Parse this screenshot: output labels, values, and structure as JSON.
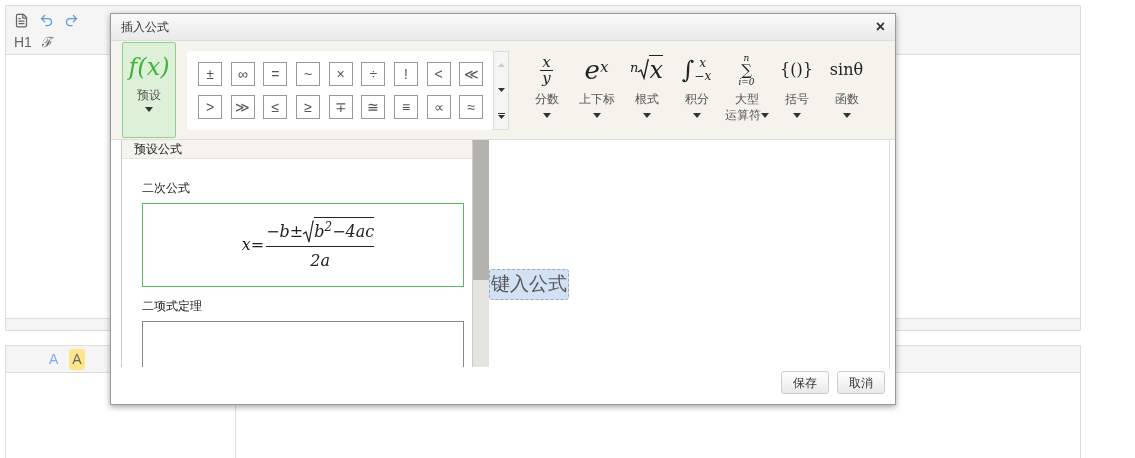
{
  "top_editor": {
    "toolbar": [
      {
        "label": "H1"
      },
      {
        "label": "ℱ"
      }
    ]
  },
  "bottom_editor": {
    "toolbar": [
      {
        "kind": "font-color",
        "label": "A"
      },
      {
        "kind": "highlight",
        "label": "A"
      }
    ]
  },
  "dialog": {
    "title": "插入公式",
    "close": "×",
    "preset": {
      "symbol": "f(x)",
      "label": "预设",
      "selected": true
    },
    "symbols": [
      "±",
      "∞",
      "=",
      "~",
      "×",
      "÷",
      "!",
      "<",
      "≪",
      ">",
      "≫",
      "≤",
      "≥",
      "∓",
      "≅",
      "≡",
      "∝",
      "≈"
    ],
    "categories": [
      {
        "kind": "fraction",
        "top": "x",
        "bottom": "y",
        "label": [
          "分数"
        ]
      },
      {
        "kind": "power",
        "base": "e",
        "sup": "x",
        "label": [
          "上下标"
        ]
      },
      {
        "kind": "root",
        "index": "n",
        "base": "x",
        "label": [
          "根式"
        ]
      },
      {
        "kind": "integral",
        "sign": "∫",
        "sup": "x",
        "sub": "−x",
        "label": [
          "积分"
        ]
      },
      {
        "kind": "sum",
        "sign": "∑",
        "sup": "n",
        "sub": "i=0",
        "label": [
          "大型",
          "运算符"
        ]
      },
      {
        "kind": "plain",
        "text": "{()}",
        "label": [
          "括号"
        ]
      },
      {
        "kind": "plain",
        "text": "sinθ",
        "label": [
          "函数"
        ]
      }
    ],
    "preset_panel": {
      "heading": "预设公式",
      "formulas": [
        {
          "name": "二次公式",
          "selected": true,
          "lhs": "x=",
          "numerator": "−b±",
          "radicand": "b$^{2}$−4ac",
          "denominator": "2a"
        },
        {
          "name": "二项式定理",
          "selected": false
        }
      ]
    },
    "editor": {
      "placeholder": "键入公式"
    },
    "buttons": [
      "保存",
      "取消"
    ]
  }
}
